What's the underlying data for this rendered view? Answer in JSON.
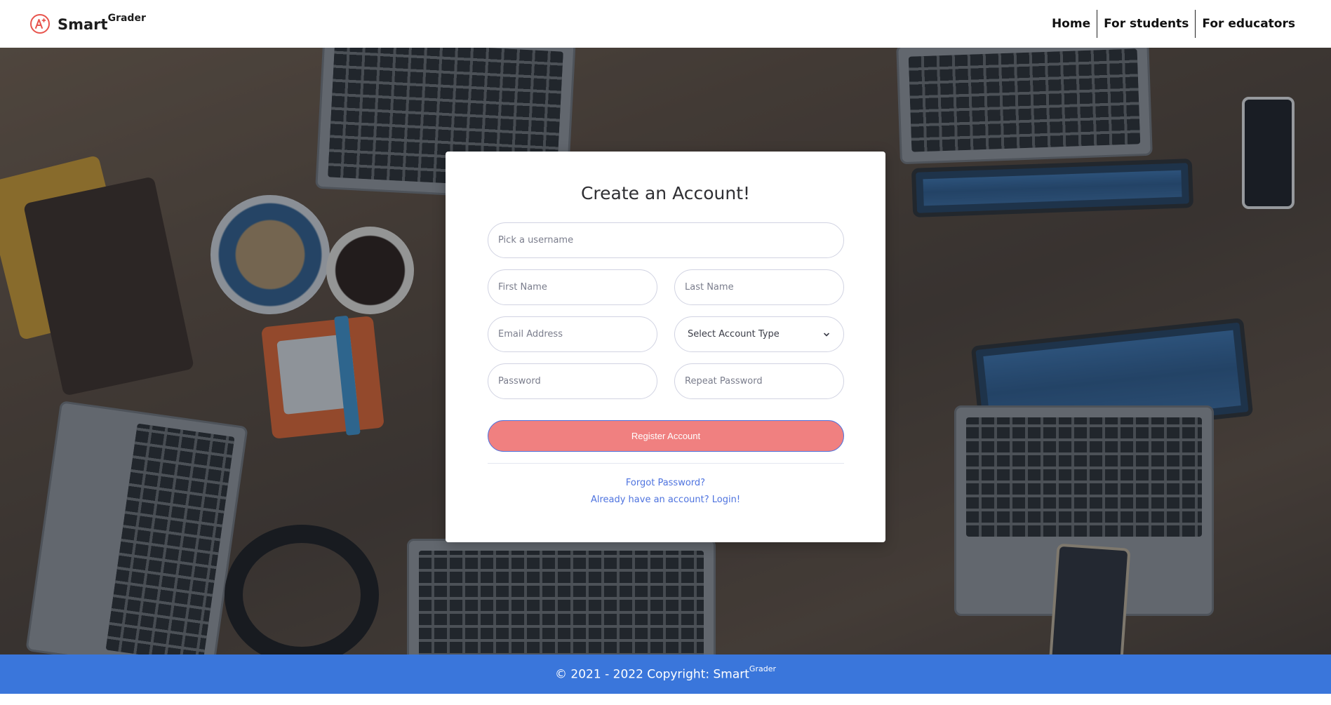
{
  "brand": {
    "name": "Smart",
    "sup": "Grader",
    "accent": "#e8554e"
  },
  "nav": {
    "items": [
      {
        "label": "Home"
      },
      {
        "label": "For students"
      },
      {
        "label": "For educators"
      }
    ]
  },
  "form": {
    "title": "Create an Account!",
    "username_placeholder": "Pick a username",
    "first_name_placeholder": "First Name",
    "last_name_placeholder": "Last Name",
    "email_placeholder": "Email Address",
    "account_type": {
      "selected": "Select Account Type",
      "icon": "chevron-down-icon"
    },
    "password_placeholder": "Password",
    "repeat_password_placeholder": "Repeat Password",
    "register_label": "Register Account",
    "forgot_label": "Forgot Password?",
    "login_label": "Already have an account? Login!"
  },
  "footer": {
    "text": "© 2021 - 2022 Copyright: Smart",
    "sup": "Grader",
    "color": "#3a76db"
  },
  "colors": {
    "button": "#f08080",
    "link": "#4e73df"
  }
}
